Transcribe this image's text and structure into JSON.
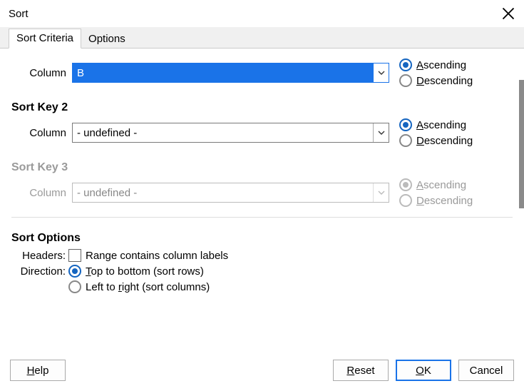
{
  "title": "Sort",
  "tabs": {
    "criteria": "Sort Criteria",
    "options": "Options"
  },
  "labels": {
    "column": "Column",
    "asc_1": "A",
    "asc_rest": "scending",
    "desc_1": "D",
    "desc_rest": "escending"
  },
  "key1": {
    "value": "B"
  },
  "key2": {
    "title": "Sort Key 2",
    "value": "- undefined -"
  },
  "key3": {
    "title": "Sort Key 3",
    "value": "- undefined -"
  },
  "options_section": {
    "title": "Sort Options",
    "headers_label": "Headers:",
    "headers_cb": "Range contains column labels",
    "direction_label": "Direction:",
    "dir_tb_1": "T",
    "dir_tb_rest": "op to bottom (sort rows)",
    "dir_lr_pre": "Left to ",
    "dir_lr_1": "r",
    "dir_lr_rest": "ight (sort columns)"
  },
  "buttons": {
    "help_1": "H",
    "help_rest": "elp",
    "reset_1": "R",
    "reset_rest": "eset",
    "ok_1": "O",
    "ok_rest": "K",
    "cancel": "Cancel"
  }
}
